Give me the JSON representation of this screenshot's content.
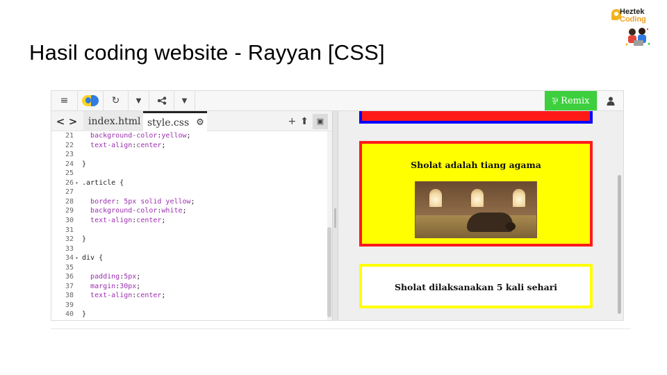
{
  "slide": {
    "title": "Hasil coding website - Rayyan  [CSS]"
  },
  "logo": {
    "line1": "Heztek",
    "line2": "Coding"
  },
  "toolbar": {
    "menu_icon": "≡",
    "refresh_icon": "↻",
    "dropdown_icon": "▼",
    "share_icon": "⋖",
    "remix_label": "Remix",
    "remix_icon": "⅌",
    "user_icon": "👤"
  },
  "tabs": {
    "nav_prev": "<",
    "nav_next": ">",
    "items": [
      {
        "label": "index.html"
      },
      {
        "label": "style.css"
      }
    ],
    "gear_icon": "⚙",
    "add_icon": "+",
    "upload_icon": "⬆",
    "image_icon": "▣"
  },
  "code": {
    "lines": [
      {
        "n": "21",
        "t": "  background-color:yellow;"
      },
      {
        "n": "22",
        "t": "  text-align:center;"
      },
      {
        "n": "23",
        "t": ""
      },
      {
        "n": "24",
        "t": "}"
      },
      {
        "n": "25",
        "t": ""
      },
      {
        "n": "26",
        "t": ".article {"
      },
      {
        "n": "27",
        "t": ""
      },
      {
        "n": "28",
        "t": "  border: 5px solid yellow;"
      },
      {
        "n": "29",
        "t": "  background-color:white;"
      },
      {
        "n": "30",
        "t": "  text-align:center;"
      },
      {
        "n": "31",
        "t": ""
      },
      {
        "n": "32",
        "t": "}"
      },
      {
        "n": "33",
        "t": ""
      },
      {
        "n": "34",
        "t": "div {"
      },
      {
        "n": "35",
        "t": ""
      },
      {
        "n": "36",
        "t": "  padding:5px;"
      },
      {
        "n": "37",
        "t": "  margin:30px;"
      },
      {
        "n": "38",
        "t": "  text-align:center;"
      },
      {
        "n": "39",
        "t": ""
      },
      {
        "n": "40",
        "t": "}"
      }
    ]
  },
  "preview": {
    "heading": "Sholat adalah tiang agama",
    "article_text": "Sholat dilaksanakan 5 kali sehari",
    "image_subject": "person-praying-in-mosque"
  },
  "colors": {
    "remix_green": "#3ecf3e",
    "box_red": "#ff1a1a",
    "box_blue": "#0000ff",
    "box_yellow": "#ffff00",
    "css_purple": "#9b2fae"
  }
}
